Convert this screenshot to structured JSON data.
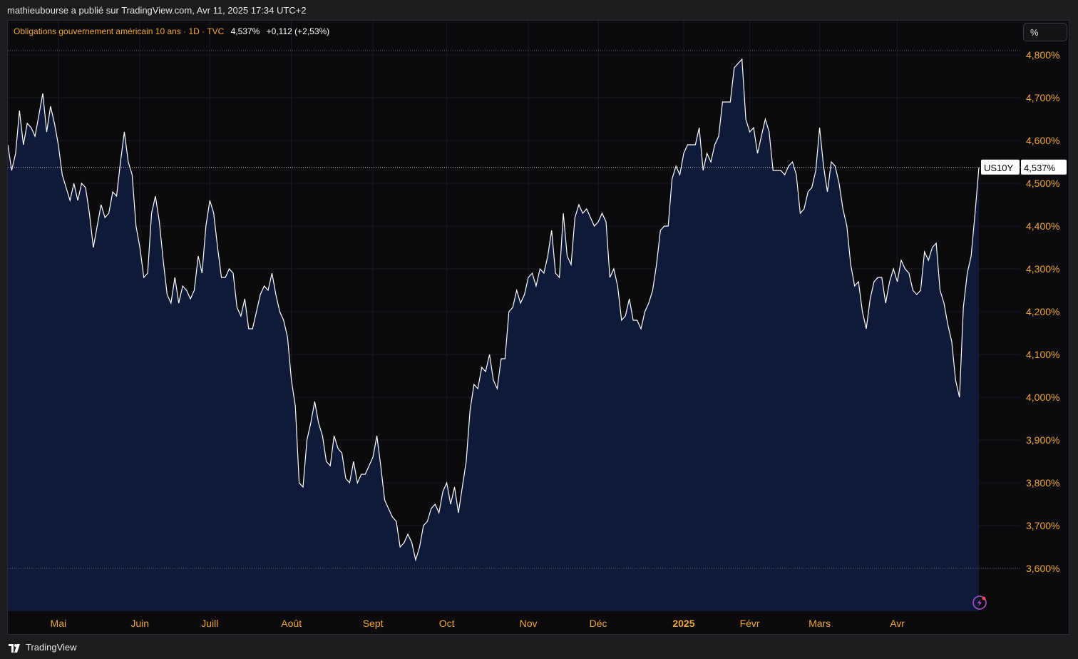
{
  "header": {
    "publisher_line": "mathieubourse a publié sur TradingView.com, Avr 11, 2025 17:34 UTC+2"
  },
  "legend": {
    "symbol_line": "Obligations gouvernement américain 10 ans · 1D · TVC",
    "last_value": "4,537%",
    "change": "+0,112 (+2,53%)"
  },
  "toolbar": {
    "unit_label": "%"
  },
  "price_tag": {
    "symbol": "US10Y",
    "value": "4,537%"
  },
  "footer": {
    "brand": "TradingView"
  },
  "colors": {
    "line": "#ffffff",
    "area_fill": "#0f1a3a",
    "axis_text": "#f0a637",
    "background": "#0b0b0d"
  },
  "chart_data": {
    "type": "area",
    "title": "Obligations gouvernement américain 10 ans · 1D · TVC",
    "xlabel": "",
    "ylabel": "",
    "ylim": [
      3.5,
      4.88
    ],
    "x_axis_labels": [
      {
        "label": "Mai",
        "t": 13,
        "bold": false
      },
      {
        "label": "Juin",
        "t": 34,
        "bold": false
      },
      {
        "label": "Juill",
        "t": 52,
        "bold": false
      },
      {
        "label": "Août",
        "t": 73,
        "bold": false
      },
      {
        "label": "Sept",
        "t": 94,
        "bold": false
      },
      {
        "label": "Oct",
        "t": 113,
        "bold": false
      },
      {
        "label": "Nov",
        "t": 134,
        "bold": false
      },
      {
        "label": "Déc",
        "t": 152,
        "bold": false
      },
      {
        "label": "2025",
        "t": 174,
        "bold": true
      },
      {
        "label": "Févr",
        "t": 191,
        "bold": false
      },
      {
        "label": "Mars",
        "t": 209,
        "bold": false
      },
      {
        "label": "Avr",
        "t": 229,
        "bold": false
      }
    ],
    "y_ticks": [
      {
        "value": 4.8,
        "label": "4,800%"
      },
      {
        "value": 4.7,
        "label": "4,700%"
      },
      {
        "value": 4.6,
        "label": "4,600%"
      },
      {
        "value": 4.5,
        "label": "4,500%"
      },
      {
        "value": 4.4,
        "label": "4,400%"
      },
      {
        "value": 4.3,
        "label": "4,300%"
      },
      {
        "value": 4.2,
        "label": "4,200%"
      },
      {
        "value": 4.1,
        "label": "4,100%"
      },
      {
        "value": 4.0,
        "label": "4,000%"
      },
      {
        "value": 3.9,
        "label": "3,900%"
      },
      {
        "value": 3.8,
        "label": "3,800%"
      },
      {
        "value": 3.7,
        "label": "3,700%"
      },
      {
        "value": 3.6,
        "label": "3,600%"
      }
    ],
    "high_line": 4.81,
    "low_line": 3.6,
    "last_value": 4.537,
    "grid": true,
    "series": [
      {
        "values": [
          4.59,
          4.53,
          4.57,
          4.67,
          4.59,
          4.64,
          4.63,
          4.61,
          4.66,
          4.71,
          4.62,
          4.68,
          4.64,
          4.59,
          4.52,
          4.49,
          4.46,
          4.5,
          4.46,
          4.5,
          4.49,
          4.43,
          4.35,
          4.4,
          4.45,
          4.42,
          4.43,
          4.48,
          4.47,
          4.55,
          4.62,
          4.55,
          4.52,
          4.4,
          4.35,
          4.28,
          4.29,
          4.43,
          4.47,
          4.41,
          4.32,
          4.24,
          4.22,
          4.28,
          4.22,
          4.26,
          4.25,
          4.23,
          4.25,
          4.33,
          4.29,
          4.4,
          4.46,
          4.43,
          4.35,
          4.28,
          4.28,
          4.3,
          4.29,
          4.21,
          4.19,
          4.23,
          4.16,
          4.16,
          4.2,
          4.24,
          4.26,
          4.25,
          4.29,
          4.24,
          4.2,
          4.18,
          4.14,
          4.04,
          3.98,
          3.8,
          3.79,
          3.9,
          3.94,
          3.99,
          3.94,
          3.91,
          3.85,
          3.84,
          3.91,
          3.88,
          3.87,
          3.81,
          3.8,
          3.85,
          3.8,
          3.82,
          3.82,
          3.84,
          3.86,
          3.91,
          3.84,
          3.76,
          3.74,
          3.72,
          3.71,
          3.65,
          3.66,
          3.68,
          3.66,
          3.62,
          3.65,
          3.7,
          3.71,
          3.74,
          3.75,
          3.73,
          3.78,
          3.8,
          3.75,
          3.79,
          3.73,
          3.79,
          3.85,
          3.97,
          4.03,
          4.02,
          4.07,
          4.06,
          4.1,
          4.04,
          4.02,
          4.09,
          4.09,
          4.2,
          4.21,
          4.25,
          4.22,
          4.24,
          4.28,
          4.29,
          4.26,
          4.3,
          4.29,
          4.33,
          4.39,
          4.29,
          4.28,
          4.43,
          4.33,
          4.31,
          4.42,
          4.45,
          4.43,
          4.44,
          4.42,
          4.4,
          4.41,
          4.43,
          4.41,
          4.28,
          4.3,
          4.26,
          4.18,
          4.19,
          4.23,
          4.18,
          4.18,
          4.16,
          4.2,
          4.22,
          4.25,
          4.31,
          4.39,
          4.4,
          4.4,
          4.51,
          4.54,
          4.52,
          4.57,
          4.59,
          4.59,
          4.59,
          4.63,
          4.53,
          4.57,
          4.55,
          4.59,
          4.61,
          4.69,
          4.69,
          4.69,
          4.77,
          4.78,
          4.79,
          4.65,
          4.62,
          4.63,
          4.57,
          4.61,
          4.65,
          4.62,
          4.53,
          4.53,
          4.53,
          4.52,
          4.54,
          4.55,
          4.52,
          4.43,
          4.44,
          4.48,
          4.49,
          4.53,
          4.63,
          4.54,
          4.48,
          4.55,
          4.54,
          4.5,
          4.44,
          4.4,
          4.31,
          4.26,
          4.27,
          4.2,
          4.16,
          4.23,
          4.27,
          4.28,
          4.28,
          4.22,
          4.27,
          4.3,
          4.27,
          4.32,
          4.3,
          4.29,
          4.25,
          4.24,
          4.25,
          4.34,
          4.32,
          4.35,
          4.36,
          4.25,
          4.22,
          4.17,
          4.13,
          4.04,
          4.0,
          4.21,
          4.29,
          4.33,
          4.43,
          4.537
        ]
      }
    ]
  }
}
